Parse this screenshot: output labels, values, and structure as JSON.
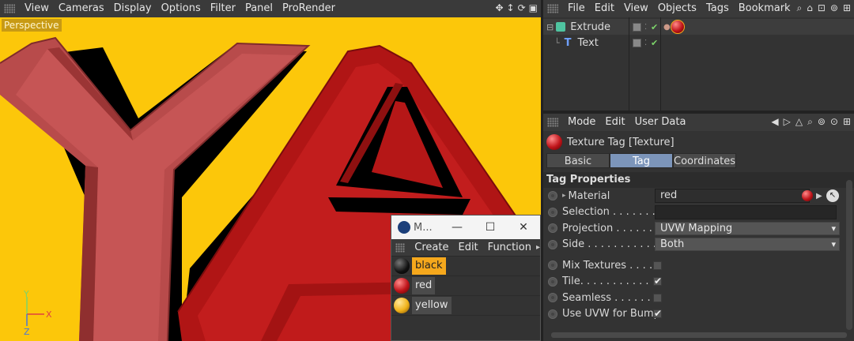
{
  "viewport": {
    "menu": [
      "View",
      "Cameras",
      "Display",
      "Options",
      "Filter",
      "Panel",
      "ProRender"
    ],
    "camera_label": "Perspective",
    "axis": {
      "y": "Y",
      "x": "X",
      "z": "Z"
    },
    "background_color": "#fcc70a",
    "letters": "YA"
  },
  "material_manager": {
    "title": "M...",
    "window_controls": [
      "—",
      "☐",
      "✕"
    ],
    "menu": [
      "Create",
      "Edit",
      "Function"
    ],
    "materials": [
      {
        "name": "black",
        "color": "#1a1a1a",
        "selected": true
      },
      {
        "name": "red",
        "color": "#c0151b",
        "selected": false
      },
      {
        "name": "yellow",
        "color": "#f0b21a",
        "selected": false
      }
    ]
  },
  "object_manager": {
    "menu": [
      "File",
      "Edit",
      "View",
      "Objects",
      "Tags",
      "Bookmark"
    ],
    "objects": [
      {
        "name": "Extrude",
        "icon": "extrude-icon"
      },
      {
        "name": "Text",
        "icon": "text-spline-icon"
      }
    ]
  },
  "attribute_manager": {
    "menu": [
      "Mode",
      "Edit",
      "User Data"
    ],
    "title": "Texture Tag [Texture]",
    "tabs": [
      "Basic",
      "Tag",
      "Coordinates"
    ],
    "active_tab": "Tag",
    "section": "Tag Properties",
    "props": {
      "material_label": "Material",
      "material_value": "red",
      "selection_label": "Selection . . . . . . . . .",
      "selection_value": "",
      "projection_label": "Projection . . . . . . . .",
      "projection_value": "UVW Mapping",
      "side_label": "Side . . . . . . . . . . . . . .",
      "side_value": "Both",
      "mix_label": "Mix Textures . . . . . .",
      "tile_label": "Tile. . . . . . . . . . . . . .",
      "seamless_label": "Seamless . . . . . . . . . .",
      "uvw_bump_label": "Use UVW for Bump"
    },
    "checks": {
      "mix": "",
      "tile": "✔",
      "seamless": "",
      "uvw_bump": "✔"
    }
  }
}
